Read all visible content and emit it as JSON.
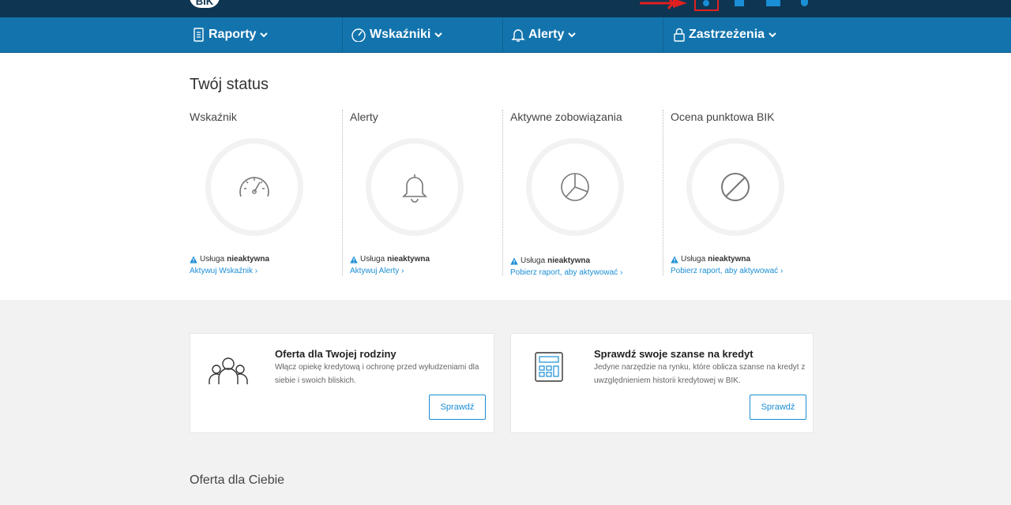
{
  "header": {
    "logo_text": "BIK"
  },
  "nav": {
    "items": [
      {
        "label": "Raporty",
        "icon": "document-icon"
      },
      {
        "label": "Wskaźniki",
        "icon": "gauge-icon"
      },
      {
        "label": "Alerty",
        "icon": "bell-icon"
      },
      {
        "label": "Zastrzeżenia",
        "icon": "lock-icon"
      }
    ]
  },
  "status": {
    "title": "Twój status",
    "columns": [
      {
        "title": "Wskaźnik",
        "icon": "gauge-icon",
        "warn_prefix": "Usługa",
        "warn_bold": "nieaktywna",
        "link": "Aktywuj Wskaźnik ›"
      },
      {
        "title": "Alerty",
        "icon": "bell-icon",
        "warn_prefix": "Usługa",
        "warn_bold": "nieaktywna",
        "link": "Aktywuj Alerty ›"
      },
      {
        "title": "Aktywne zobowiązania",
        "icon": "pie-chart-icon",
        "warn_prefix": "Usługa",
        "warn_bold": "nieaktywna",
        "link": "Pobierz raport, aby aktywować ›"
      },
      {
        "title": "Ocena punktowa BIK",
        "icon": "disabled-icon",
        "warn_prefix": "Usługa",
        "warn_bold": "nieaktywna",
        "link": "Pobierz raport, aby aktywować ›"
      }
    ]
  },
  "cards": [
    {
      "title": "Oferta dla Twojej rodziny",
      "description": "Włącz opiekę kredytową i ochronę przed wyłudzeniami dla siebie i swoich bliskich.",
      "button": "Sprawdź",
      "icon": "family-icon"
    },
    {
      "title": "Sprawdź swoje szanse na kredyt",
      "description": "Jedyne narzędzie na rynku, które oblicza szanse na kredyt z uwzględnieniem historii kredytowej w BIK.",
      "button": "Sprawdź",
      "icon": "calculator-icon"
    }
  ],
  "offer": {
    "title": "Oferta dla Ciebie"
  },
  "colors": {
    "topbar": "#0e3552",
    "nav": "#1374ad",
    "accent": "#1a8ed6",
    "highlight": "#e02020"
  }
}
